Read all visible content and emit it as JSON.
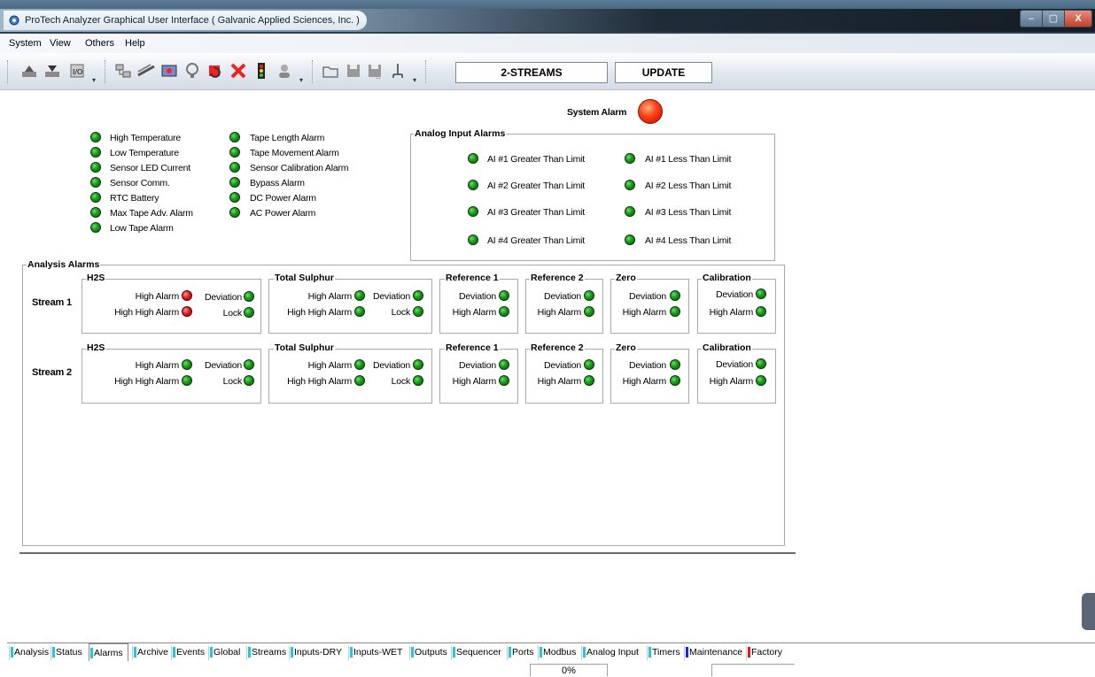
{
  "window": {
    "title": "ProTech Analyzer Graphical User Interface  ( Galvanic Applied Sciences, Inc. )",
    "controls": {
      "minimize": "–",
      "maximize": "▢",
      "close": "X"
    }
  },
  "menu": [
    "System",
    "View",
    "Others",
    "Help"
  ],
  "toolbar": {
    "streams_label": "2-STREAMS",
    "update_label": "UPDATE"
  },
  "system_alarm": {
    "label": "System Alarm",
    "state": "red"
  },
  "general_alarms": {
    "col1": [
      {
        "label": "High Temperature",
        "state": "green"
      },
      {
        "label": "Low Temperature",
        "state": "green"
      },
      {
        "label": "Sensor LED Current",
        "state": "green"
      },
      {
        "label": "Sensor Comm.",
        "state": "green"
      },
      {
        "label": "RTC Battery",
        "state": "green"
      },
      {
        "label": "Max Tape Adv. Alarm",
        "state": "green"
      },
      {
        "label": "Low Tape Alarm",
        "state": "green"
      }
    ],
    "col2": [
      {
        "label": "Tape Length Alarm",
        "state": "green"
      },
      {
        "label": "Tape Movement Alarm",
        "state": "green"
      },
      {
        "label": "Sensor Calibration Alarm",
        "state": "green"
      },
      {
        "label": "Bypass Alarm",
        "state": "green"
      },
      {
        "label": "DC Power Alarm",
        "state": "green"
      },
      {
        "label": "AC Power Alarm",
        "state": "green"
      }
    ]
  },
  "analog_input_alarms": {
    "title": "Analog Input Alarms",
    "greater": [
      "AI #1 Greater Than Limit",
      "AI #2 Greater Than Limit",
      "AI #3 Greater Than Limit",
      "AI #4 Greater Than Limit"
    ],
    "less": [
      "AI #1 Less Than Limit",
      "AI #2 Less Than Limit",
      "AI #3 Less Than Limit",
      "AI #4 Less Than Limit"
    ]
  },
  "analysis_alarms": {
    "title": "Analysis Alarms",
    "streams": [
      {
        "label": "Stream 1",
        "h2s": {
          "title": "H2S",
          "high": "High Alarm",
          "high_high": "High High Alarm",
          "deviation": "Deviation",
          "lock": "Lock",
          "states": {
            "high": "red",
            "high_high": "red",
            "deviation": "green",
            "lock": "green"
          }
        },
        "ts": {
          "title": "Total Sulphur",
          "high": "High Alarm",
          "high_high": "High High Alarm",
          "deviation": "Deviation",
          "lock": "Lock"
        },
        "ref1": {
          "title": "Reference 1",
          "a": "Deviation",
          "b": "High Alarm"
        },
        "ref2": {
          "title": "Reference 2",
          "a": "Deviation",
          "b": "High Alarm"
        },
        "zero": {
          "title": "Zero",
          "a": "Deviation",
          "b": "High Alarm"
        },
        "cal": {
          "title": "Calibration",
          "a": "Deviation",
          "b": "High Alarm"
        }
      },
      {
        "label": "Stream 2",
        "h2s": {
          "title": "H2S",
          "high": "High Alarm",
          "high_high": "High High Alarm",
          "deviation": "Deviation",
          "lock": "Lock",
          "states": {
            "high": "green",
            "high_high": "green",
            "deviation": "green",
            "lock": "green"
          }
        },
        "ts": {
          "title": "Total Sulphur",
          "high": "High Alarm",
          "high_high": "High High Alarm",
          "deviation": "Deviation",
          "lock": "Lock"
        },
        "ref1": {
          "title": "Reference 1",
          "a": "Deviation",
          "b": "High Alarm"
        },
        "ref2": {
          "title": "Reference 2",
          "a": "Deviation",
          "b": "High Alarm"
        },
        "zero": {
          "title": "Zero",
          "a": "Deviation",
          "b": "High Alarm"
        },
        "cal": {
          "title": "Calibration",
          "a": "Deviation",
          "b": "High Alarm"
        }
      }
    ]
  },
  "tabs": [
    {
      "label": "Analysis",
      "color": "#22c7d9"
    },
    {
      "label": "Status",
      "color": "#22c7d9"
    },
    {
      "label": "Alarms",
      "color": "#22c7d9",
      "active": true
    },
    {
      "label": "Archive",
      "color": "#22c7d9"
    },
    {
      "label": "Events",
      "color": "#22c7d9"
    },
    {
      "label": "Global",
      "color": "#22c7d9"
    },
    {
      "label": "Streams",
      "color": "#22c7d9"
    },
    {
      "label": "Inputs-DRY",
      "color": "#22c7d9"
    },
    {
      "label": "Inputs-WET",
      "color": "#22c7d9"
    },
    {
      "label": "Outputs",
      "color": "#22c7d9"
    },
    {
      "label": "Sequencer",
      "color": "#22c7d9"
    },
    {
      "label": "Ports",
      "color": "#22c7d9"
    },
    {
      "label": "Modbus",
      "color": "#22c7d9"
    },
    {
      "label": "Analog Input",
      "color": "#22c7d9"
    },
    {
      "label": "Timers",
      "color": "#22c7d9"
    },
    {
      "label": "Maintenance",
      "color": "#1a2bd6"
    },
    {
      "label": "Factory",
      "color": "#e01818"
    }
  ],
  "statusbar": {
    "progress_text": "0%"
  }
}
